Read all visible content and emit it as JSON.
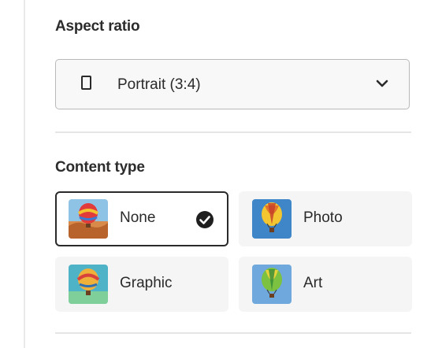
{
  "aspect_ratio": {
    "title": "Aspect ratio",
    "selected_label": "Portrait (3:4)",
    "icon": "portrait-rectangle-icon",
    "dropdown_icon": "chevron-down-icon"
  },
  "content_type": {
    "title": "Content type",
    "options": [
      {
        "label": "None",
        "selected": true,
        "thumbnail": "hot-air-balloon-desert"
      },
      {
        "label": "Photo",
        "selected": false,
        "thumbnail": "hot-air-balloon-sky"
      },
      {
        "label": "Graphic",
        "selected": false,
        "thumbnail": "hot-air-balloon-teal"
      },
      {
        "label": "Art",
        "selected": false,
        "thumbnail": "hot-air-balloon-green"
      }
    ],
    "selected_icon": "checkmark-circle-icon"
  },
  "colors": {
    "tile_background": "#f5f5f5",
    "selected_border": "#2a2a2a",
    "dropdown_border": "#b9b9b9",
    "divider": "#e5e5e5"
  }
}
